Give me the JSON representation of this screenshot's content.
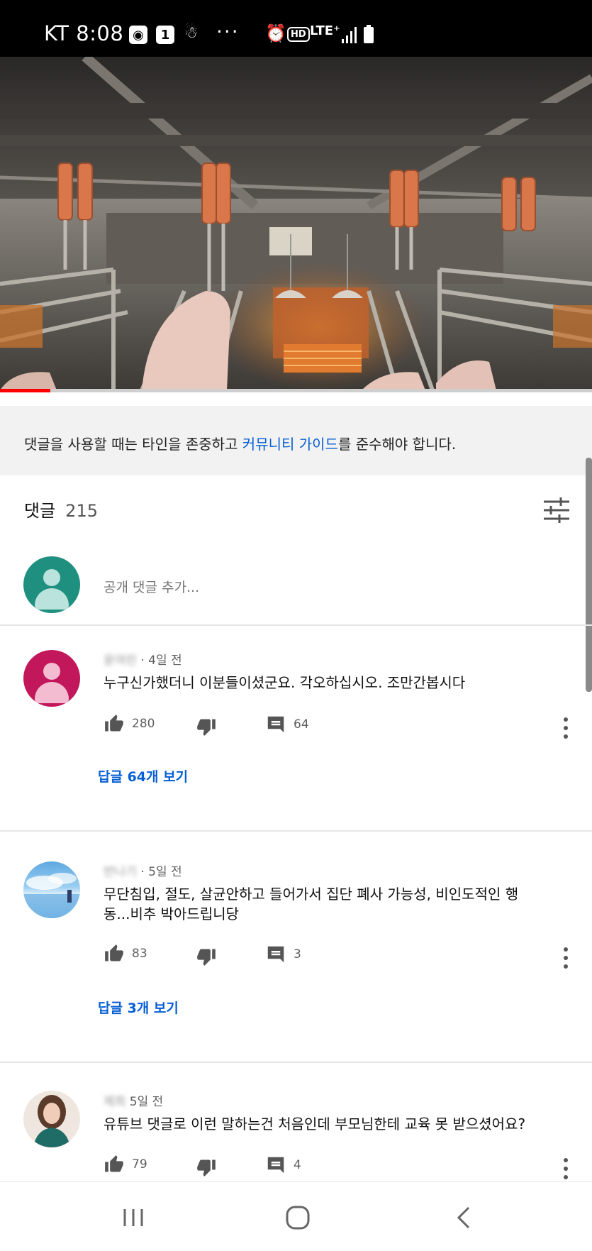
{
  "status_bar": {
    "carrier_time": "KT 8:08",
    "notif_badge": "1",
    "more": "···",
    "hd": "HD",
    "network": "LTE⁺"
  },
  "video": {
    "progress_fraction": 0.085
  },
  "guide_banner": {
    "prefix": "댓글을 사용할 때는 타인을 존중하고 ",
    "link": "커뮤니티 가이드",
    "suffix": "를 준수해야 합니다."
  },
  "comments_header": {
    "label": "댓글",
    "count": "215"
  },
  "add_comment": {
    "placeholder": "공개 댓글 추가..."
  },
  "comments": [
    {
      "author": "윤여린",
      "time": "· 4일 전",
      "text": "누구신가했더니 이분들이셨군요. 각오하십시오. 조만간봅시다",
      "likes": "280",
      "reply_count": "64",
      "view_replies": "답글 64개 보기"
    },
    {
      "author": "반나기",
      "time": "· 5일 전",
      "text": "무단침입, 절도, 살균안하고 들어가서 집단 폐사 가능성, 비인도적인 행동...비추 박아드립니당",
      "likes": "83",
      "reply_count": "3",
      "view_replies": "답글 3개 보기"
    },
    {
      "author": "제희",
      "time": "5일 전",
      "text": "유튜브 댓글로 이런 말하는건 처음인데 부모님한테 교육 못 받으셨어요?",
      "likes": "79",
      "reply_count": "4"
    }
  ],
  "colors": {
    "accent_link": "#065fd4",
    "progress": "#ff0000",
    "avatar_self": "#1f8f7f",
    "avatar_1": "#c2185b"
  }
}
